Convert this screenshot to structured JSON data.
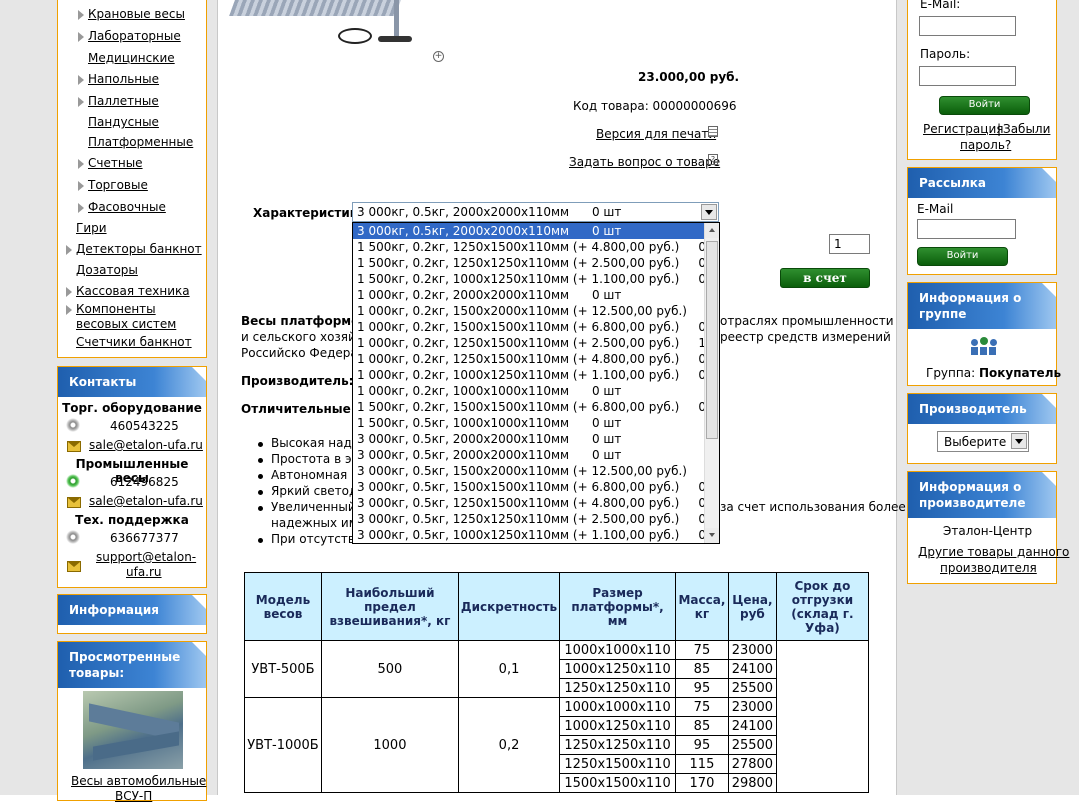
{
  "categories": {
    "sub_items": [
      {
        "label": "Крановые весы",
        "arrow": true
      },
      {
        "label": "Лабораторные",
        "arrow": true
      },
      {
        "label": "Медицинские",
        "arrow": false
      },
      {
        "label": "Напольные",
        "arrow": true
      },
      {
        "label": "Паллетные",
        "arrow": true
      },
      {
        "label": "Пандусные",
        "arrow": false
      },
      {
        "label": "Платформенные",
        "arrow": false
      },
      {
        "label": "Счетные",
        "arrow": true
      },
      {
        "label": "Торговые",
        "arrow": true
      },
      {
        "label": "Фасовочные",
        "arrow": true
      }
    ],
    "top_items": [
      {
        "label": "Гири",
        "arrow": false
      },
      {
        "label": "Детекторы банкнот",
        "arrow": true
      },
      {
        "label": "Дозаторы",
        "arrow": false
      },
      {
        "label": "Кассовая техника",
        "arrow": true
      },
      {
        "label": "Компоненты весовых систем",
        "arrow": true
      },
      {
        "label": "Счетчики банкнот",
        "arrow": false
      }
    ]
  },
  "contacts": {
    "title": "Контакты",
    "torg_title": "Торг. оборудование",
    "torg_icq": "460543225",
    "torg_email": "sale@etalon-ufa.ru",
    "prom_title": "Промышленные весы",
    "prom_icq": "612496825",
    "prom_email": "sale@etalon-ufa.ru",
    "support_title": "Тех. поддержка",
    "support_icq": "636677377",
    "support_email_line1": "support@etalon-",
    "support_email_line2": "ufa.ru"
  },
  "info_box": {
    "title": "Информация"
  },
  "viewed": {
    "title_line1": "Просмотренные",
    "title_line2": "товары:",
    "item_line1": "Весы автомобильные",
    "item_line2": "ВСУ-П"
  },
  "product": {
    "price": "23.000,00 руб.",
    "code_label": "Код товара: 00000000696",
    "print_link": "Версия для печати",
    "ask_link": "Задать вопрос о товаре",
    "char_label": "Характеристики:",
    "selected_option": "3 000кг, 0.5кг, 2000х2000х110мм      0 шт",
    "quantity": "1",
    "cart_button": "в счет",
    "desc_bold": "Весы платформен",
    "desc_line1_right": "отраслях промышленности",
    "desc_line2_left": "и сельского хозяйс",
    "desc_line2_right": "реестр средств измерений",
    "desc_line3_left": "Российско Федерац",
    "manufacturer_label": "Производитель:",
    "manufacturer_value": "ОО",
    "features_label": "Отличительные ос",
    "bullets": [
      "Высокая наде",
      "Простота в экс",
      "Автономная ра",
      "Яркий светоди",
      "Увеличенный д",
      "При отсутствии"
    ],
    "bullet5_right": "за счет использования более",
    "bullet5_line2": "надежных имп"
  },
  "dropdown_options": [
    "3 000кг, 0.5кг, 2000х2000х110мм      0 шт",
    "1 500кг, 0.2кг, 1250х1500х110мм (+ 4.800,00 руб.)     0 шт",
    "1 500кг, 0.2кг, 1250х1250х110мм (+ 2.500,00 руб.)     0 шт",
    "1 500кг, 0.2кг, 1000х1250х110мм (+ 1.100,00 руб.)     0 шт",
    "1 000кг, 0.2кг, 2000х2000х110мм      0 шт",
    "1 000кг, 0.2кг, 1500х2000х110мм (+ 12.500,00 руб.)     0 шт",
    "1 000кг, 0.2кг, 1500х1500х110мм (+ 6.800,00 руб.)     0 шт",
    "1 000кг, 0.2кг, 1250х1500х110мм (+ 2.500,00 руб.)     1 шт",
    "1 000кг, 0.2кг, 1250х1500х110мм (+ 4.800,00 руб.)     0 шт",
    "1 000кг, 0.2кг, 1000х1250х110мм (+ 1.100,00 руб.)     0 шт",
    "1 000кг, 0.2кг, 1000х1000х110мм      0 шт",
    "1 500кг, 0.2кг, 1500х1500х110мм (+ 6.800,00 руб.)     0 шт",
    "1 500кг, 0.5кг, 1000х1000х110мм      0 шт",
    "3 000кг, 0.5кг, 2000х2000х110мм      0 шт",
    "3 000кг, 0.5кг, 2000х2000х110мм      0 шт",
    "3 000кг, 0.5кг, 1500х2000х110мм (+ 12.500,00 руб.)     0 шт",
    "3 000кг, 0.5кг, 1500х1500х110мм (+ 6.800,00 руб.)     0 шт",
    "3 000кг, 0.5кг, 1250х1500х110мм (+ 4.800,00 руб.)     0 шт",
    "3 000кг, 0.5кг, 1250х1250х110мм (+ 2.500,00 руб.)     0 шт",
    "3 000кг, 0.5кг, 1000х1250х110мм (+ 1.100,00 руб.)     0 шт"
  ],
  "table": {
    "headers": [
      "Модель весов",
      "Наибольший предел взвешивания*, кг",
      "Дискретность",
      "Размер платформы*, мм",
      "Масса, кг",
      "Цена, руб",
      "Срок до отгрузки (склад г. Уфа)"
    ],
    "groups": [
      {
        "model": "УВТ-500Б",
        "max": "500",
        "disc": "0,1",
        "rows": [
          [
            "1000х1000х110",
            "75",
            "23000"
          ],
          [
            "1000х1250х110",
            "85",
            "24100"
          ],
          [
            "1250х1250х110",
            "95",
            "25500"
          ]
        ]
      },
      {
        "model": "УВТ-1000Б",
        "max": "1000",
        "disc": "0,2",
        "rows": [
          [
            "1000х1000х110",
            "75",
            "23000"
          ],
          [
            "1000х1250х110",
            "85",
            "24100"
          ],
          [
            "1250х1250х110",
            "95",
            "25500"
          ],
          [
            "1250х1500х110",
            "115",
            "27800"
          ],
          [
            "1500х1500х110",
            "170",
            "29800"
          ]
        ]
      }
    ]
  },
  "login": {
    "email_label": "E-Mail:",
    "password_label": "Пароль:",
    "login_button": "Войти",
    "register_link": "Регистрация",
    "separator": "|",
    "forgot_line1": "Забыли",
    "forgot_line2": "пароль?"
  },
  "newsletter": {
    "title": "Рассылка",
    "email_label": "E-Mail",
    "button": "Войти"
  },
  "group_info": {
    "title_line1": "Информация о",
    "title_line2": "группе",
    "group_label": "Группа:",
    "group_value": "Покупатель"
  },
  "manufacturer_box": {
    "title": "Производитель",
    "select_value": "Выберите"
  },
  "manufacturer_info": {
    "title_line1": "Информация о",
    "title_line2": "производителе",
    "name": "Эталон-Центр",
    "other_line1": "Другие товары данного",
    "other_line2": "производителя"
  }
}
